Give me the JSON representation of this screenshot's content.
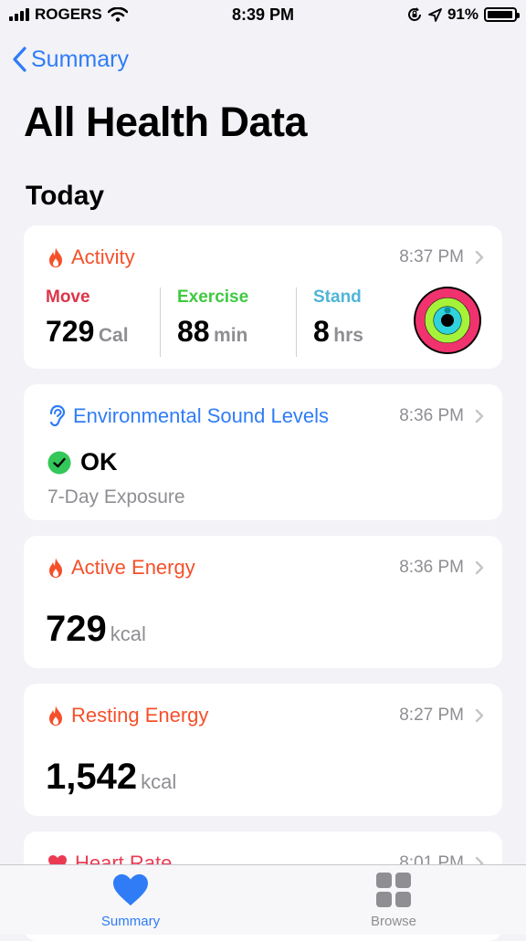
{
  "status_bar": {
    "carrier": "ROGERS",
    "time": "8:39 PM",
    "battery": "91%"
  },
  "nav": {
    "back_label": "Summary"
  },
  "page_title": "All Health Data",
  "section_title": "Today",
  "colors": {
    "accent": "#2f7cf6",
    "activity": "#f5502a",
    "move": "#dc3548",
    "exercise": "#3fc940",
    "stand": "#4fb5d6",
    "heart": "#ea3b53"
  },
  "cards": {
    "activity": {
      "title": "Activity",
      "time": "8:37 PM",
      "move": {
        "label": "Move",
        "value": "729",
        "unit": "Cal"
      },
      "exercise": {
        "label": "Exercise",
        "value": "88",
        "unit": "min"
      },
      "stand": {
        "label": "Stand",
        "value": "8",
        "unit": "hrs"
      }
    },
    "sound": {
      "title": "Environmental Sound Levels",
      "time": "8:36 PM",
      "status": "OK",
      "subtitle": "7-Day Exposure"
    },
    "active_energy": {
      "title": "Active Energy",
      "time": "8:36 PM",
      "value": "729",
      "unit": "kcal"
    },
    "resting_energy": {
      "title": "Resting Energy",
      "time": "8:27 PM",
      "value": "1,542",
      "unit": "kcal"
    },
    "heart_rate": {
      "title": "Heart Rate",
      "time": "8:01 PM"
    }
  },
  "tabbar": {
    "summary_label": "Summary",
    "browse_label": "Browse"
  },
  "icons": [
    "cellular-signal-icon",
    "wifi-icon",
    "orientation-lock-icon",
    "location-icon",
    "battery-icon",
    "chevron-left-icon",
    "flame-icon",
    "ear-icon",
    "checkmark-circle-icon",
    "chevron-right-icon",
    "activity-rings-icon",
    "heart-icon",
    "grid-icon"
  ]
}
